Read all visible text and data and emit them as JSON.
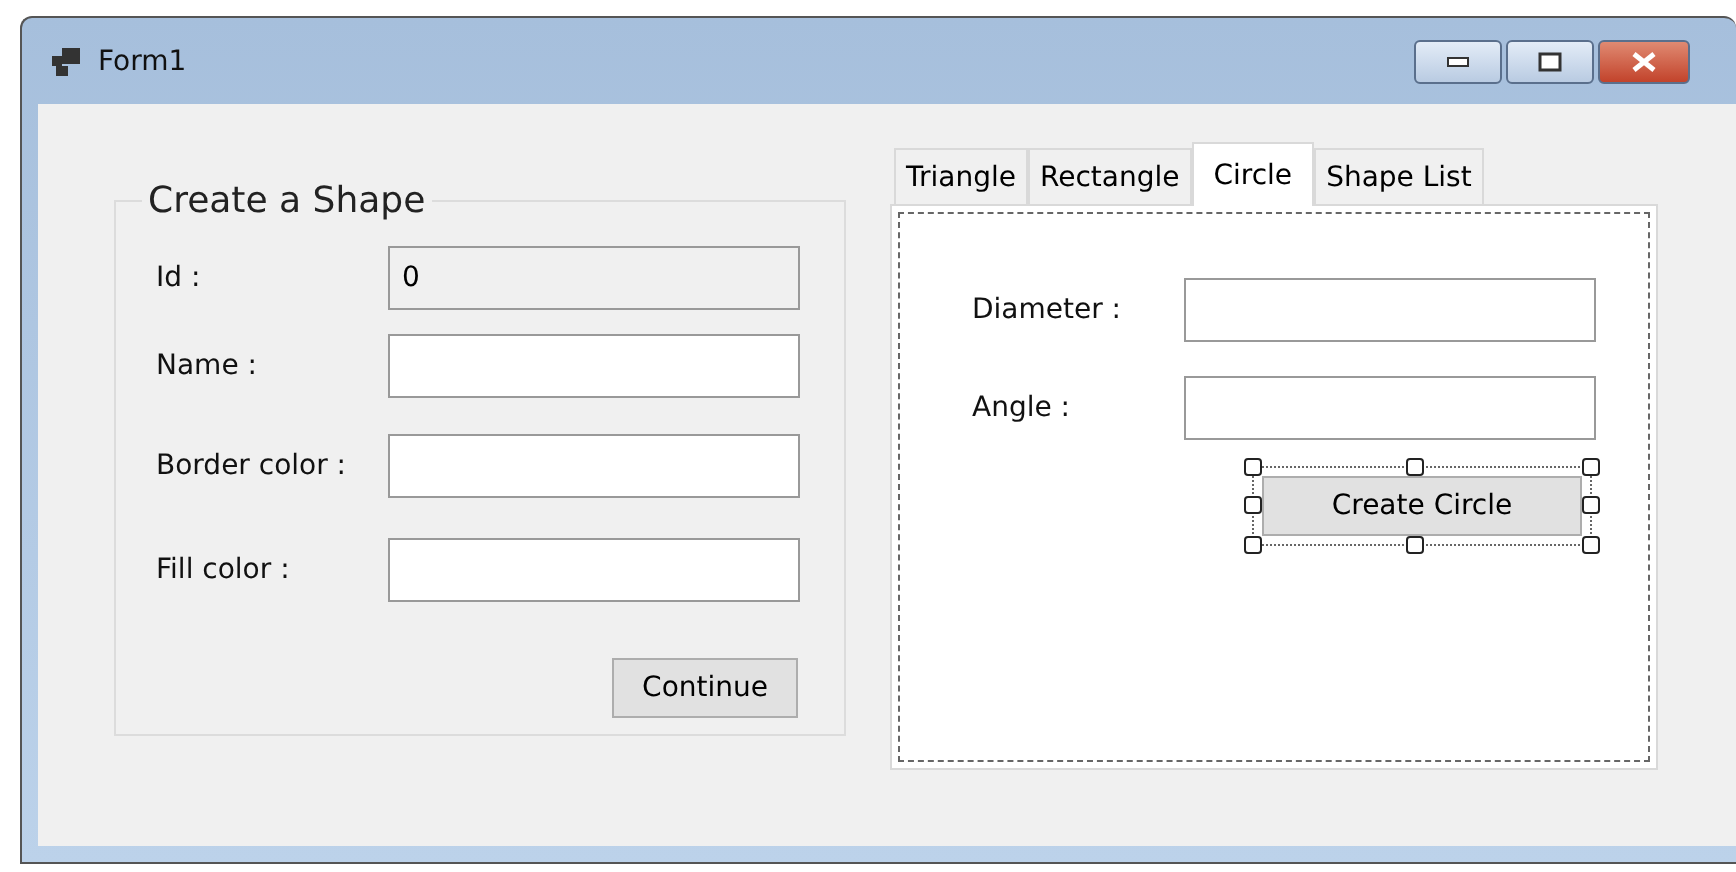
{
  "window": {
    "title": "Form1"
  },
  "group": {
    "title": "Create a Shape",
    "fields": [
      {
        "label": "Id :",
        "value": "0",
        "readonly": true
      },
      {
        "label": "Name :",
        "readonly": false
      },
      {
        "label": "Border color :",
        "readonly": false
      },
      {
        "label": "Fill color :",
        "readonly": false
      }
    ],
    "button": "Continue"
  },
  "tabs": [
    {
      "label": "Triangle",
      "selected": false
    },
    {
      "label": "Rectangle",
      "selected": false
    },
    {
      "label": "Circle",
      "selected": true
    },
    {
      "label": "Shape List",
      "selected": false
    }
  ],
  "circle_panel": {
    "fields": [
      {
        "label": "Diameter :"
      },
      {
        "label": "Angle :"
      }
    ],
    "button": {
      "label": "Create Circle",
      "designer_selected": true
    }
  }
}
